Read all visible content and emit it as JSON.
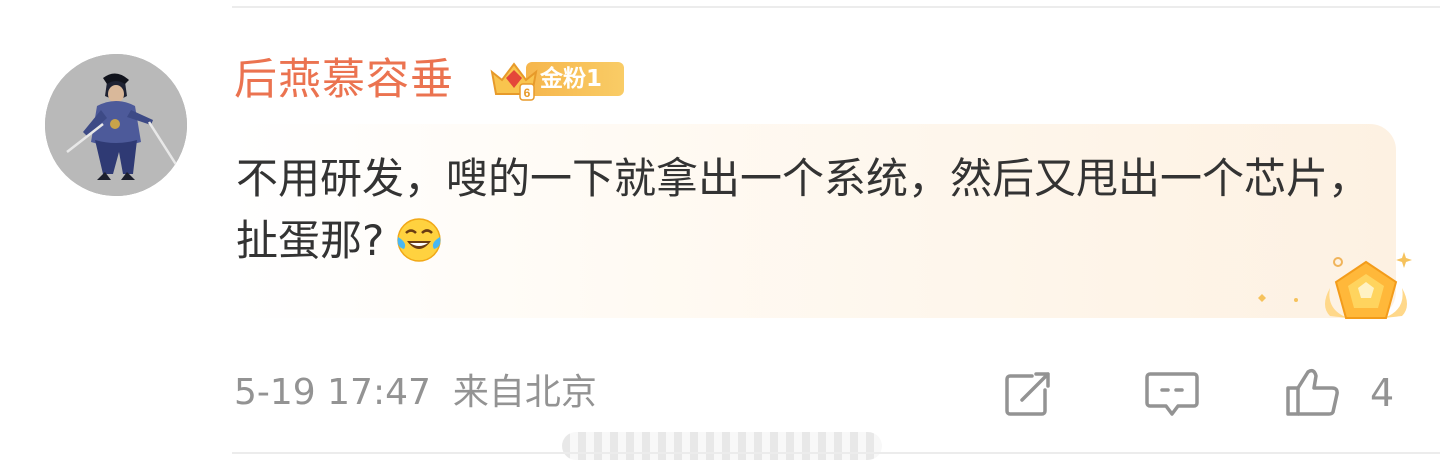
{
  "comment": {
    "username": "后燕慕容垂",
    "fan_badge": {
      "label": "金粉1",
      "level_digit": "6",
      "color": "#f6b64c"
    },
    "text": "不用研发，嗖的一下就拿出一个系统，然后又甩出一个芯片，扯蛋那?",
    "emoji_icon": "laughing-tears-emoji",
    "timestamp": "5-19 17:47",
    "location": "来自北京",
    "likes": "4",
    "colors": {
      "username": "#eb7350",
      "text": "#333333",
      "meta": "#939393"
    }
  },
  "actions": {
    "share_icon": "share-icon",
    "reply_icon": "comment-icon",
    "like_icon": "thumb-up-icon"
  }
}
